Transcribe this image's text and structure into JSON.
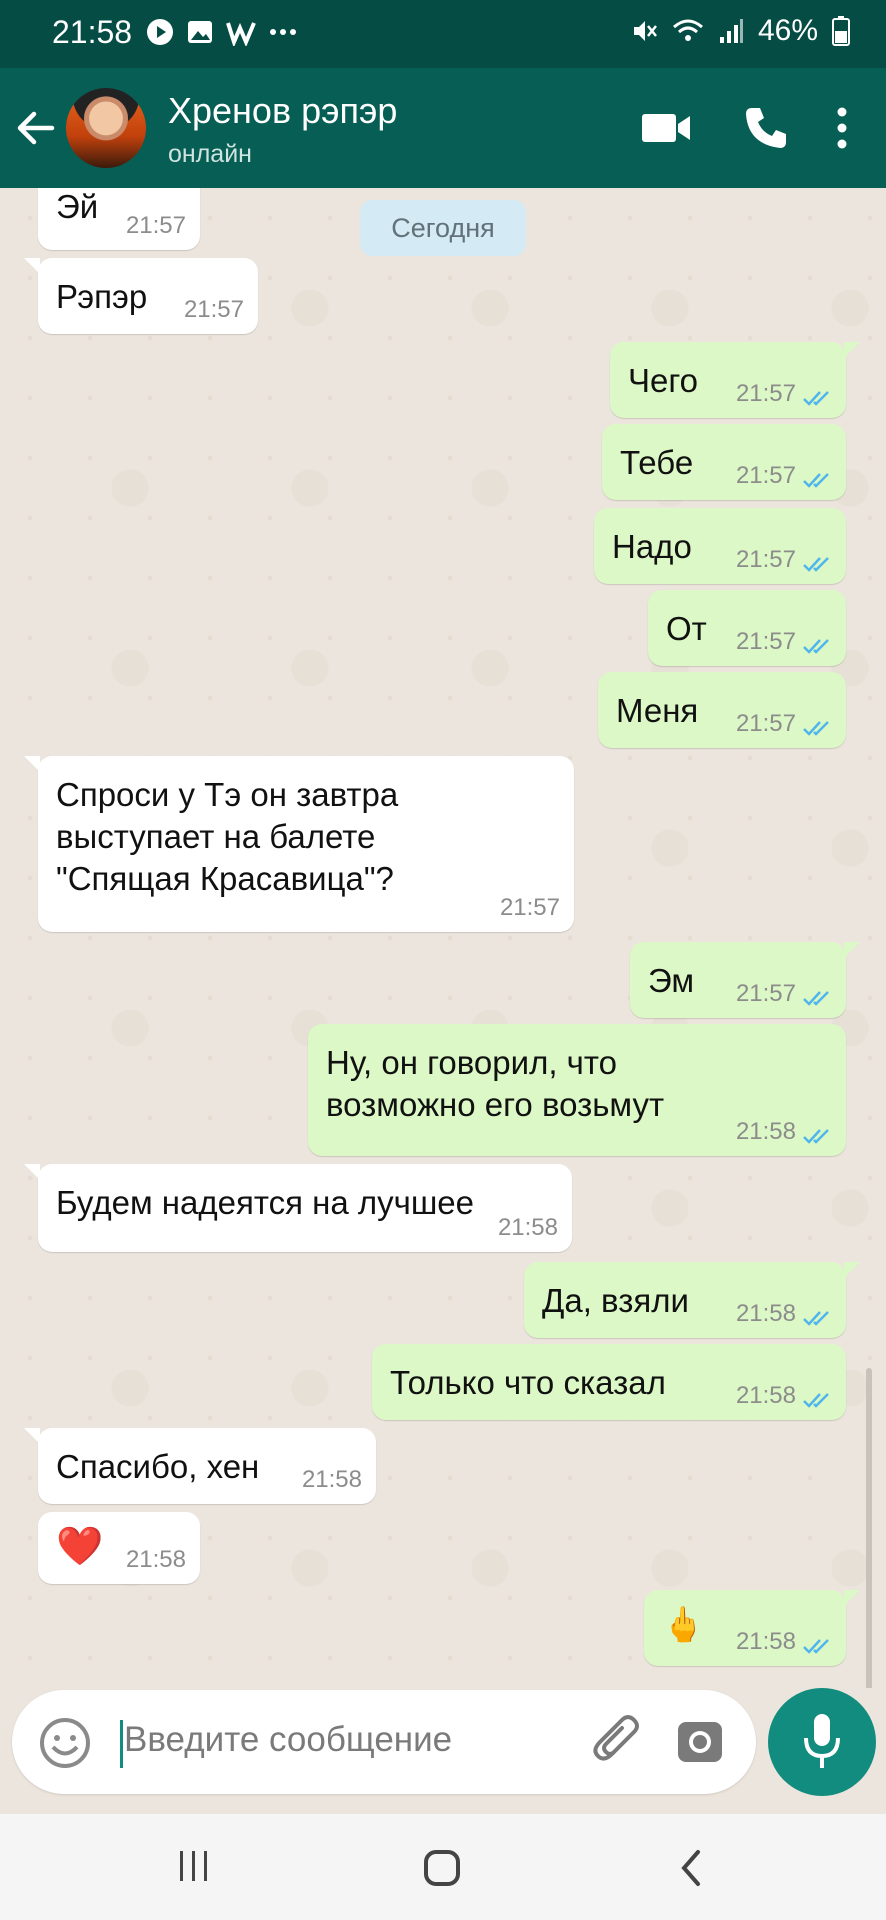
{
  "status_bar": {
    "time": "21:58",
    "battery": "46%"
  },
  "header": {
    "contact_name": "Хренов рэпэр",
    "contact_status": "онлайн"
  },
  "chat": {
    "date_chip": "Сегодня",
    "messages": [
      {
        "dir": "in",
        "text": "Эй",
        "time": "21:57"
      },
      {
        "dir": "in",
        "text": "Рэпэр",
        "time": "21:57"
      },
      {
        "dir": "out",
        "text": "Чего",
        "time": "21:57"
      },
      {
        "dir": "out",
        "text": "Тебе",
        "time": "21:57"
      },
      {
        "dir": "out",
        "text": "Надо",
        "time": "21:57"
      },
      {
        "dir": "out",
        "text": "От",
        "time": "21:57"
      },
      {
        "dir": "out",
        "text": "Меня",
        "time": "21:57"
      },
      {
        "dir": "in",
        "text": "Спроси у Тэ он завтра\nвыступает на балете\n\"Спящая Красавица\"?",
        "time": "21:57"
      },
      {
        "dir": "out",
        "text": "Эм",
        "time": "21:57"
      },
      {
        "dir": "out",
        "text": "Ну, он говорил, что\nвозможно его возьмут",
        "time": "21:58"
      },
      {
        "dir": "in",
        "text": "Будем надеятся на лучшее",
        "time": "21:58"
      },
      {
        "dir": "out",
        "text": "Да, взяли",
        "time": "21:58"
      },
      {
        "dir": "out",
        "text": "Только что сказал",
        "time": "21:58"
      },
      {
        "dir": "in",
        "text": "Спасибо, хен",
        "time": "21:58"
      },
      {
        "dir": "in",
        "text": "❤️",
        "time": "21:58"
      },
      {
        "dir": "out",
        "text": "🖕",
        "time": "21:58"
      }
    ]
  },
  "composer": {
    "placeholder": "Введите сообщение"
  },
  "colors": {
    "header": "#075e54",
    "status_bar": "#054d44",
    "outgoing_bubble": "#dcf8c6",
    "incoming_bubble": "#ffffff",
    "accent": "#128c7e",
    "read_ticks": "#4fb6ec"
  },
  "icons": [
    "back-arrow-icon",
    "video-call-icon",
    "phone-icon",
    "more-vert-icon",
    "emoji-icon",
    "attach-icon",
    "camera-icon",
    "mic-icon",
    "double-check-icon",
    "heart-emoji",
    "recents-icon",
    "home-icon",
    "back-icon"
  ]
}
